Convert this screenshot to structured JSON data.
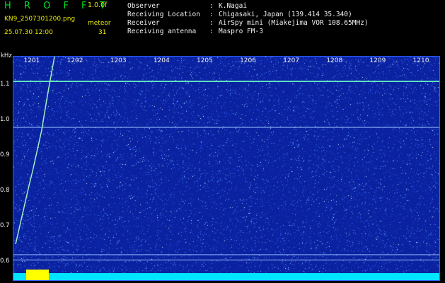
{
  "header": {
    "app_title": "H R O F F T",
    "version": "1.0.0f",
    "filename": "KN9_2507301200.png",
    "datetime": "25.07.30 12:00",
    "detector_label": "meteor",
    "count": "31",
    "observer_key": "Observer",
    "observer_value": "K.Nagai",
    "location_key": "Receiving Location",
    "location_value": "Chigasaki, Japan (139.414 35.340)",
    "receiver_key": "Receiver",
    "receiver_value": "AirSpy mini (Miakejima VOR 108.65MHz)",
    "antenna_key": "Receiving antenna",
    "antenna_value": "Maspro FM-3",
    "colon": ":"
  },
  "colors": {
    "title_green": "#00e020",
    "label_yellow": "#e8e800",
    "background_blue": "#0a22a0",
    "signal_line": "#a0f0c0",
    "bottom_band": "#00e5ff",
    "peak_yellow": "#ffff00"
  },
  "chart_data": {
    "type": "heatmap",
    "ylabel": "kHz",
    "xlabels": [
      "1201",
      "1202",
      "1203",
      "1204",
      "1205",
      "1206",
      "1207",
      "1208",
      "1209",
      "1210"
    ],
    "ylabels": [
      "1.1",
      "1.0",
      "0.9",
      "0.8",
      "0.7",
      "0.6"
    ],
    "ylim": [
      0.58,
      1.18
    ],
    "xlim": [
      1200.55,
      1210.4
    ],
    "horizontal_lines_khz": [
      1.11,
      0.98,
      0.62,
      0.605
    ],
    "meteor_trace": [
      {
        "x": 1200.6,
        "y": 0.65
      },
      {
        "x": 1200.9,
        "y": 0.81
      },
      {
        "x": 1201.0,
        "y": 0.86
      },
      {
        "x": 1201.2,
        "y": 0.97
      },
      {
        "x": 1201.35,
        "y": 1.08
      },
      {
        "x": 1201.5,
        "y": 1.18
      }
    ]
  }
}
